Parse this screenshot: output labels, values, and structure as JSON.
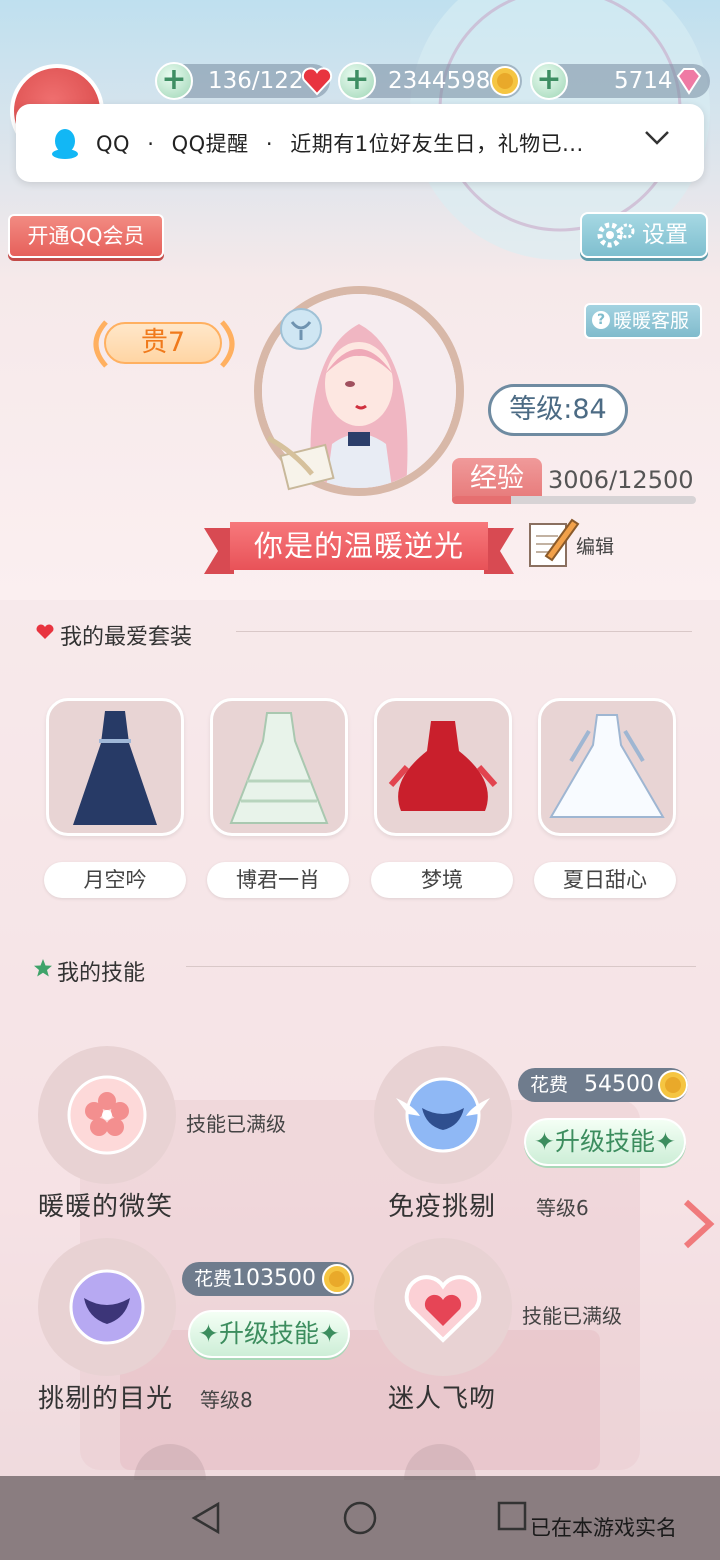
{
  "resources": {
    "stamina": "136/122",
    "gold": "2344598",
    "diamonds": "5714"
  },
  "notification": {
    "app": "QQ",
    "separator": "·",
    "channel": "QQ提醒",
    "message": "近期有1位好友生日，礼物已..."
  },
  "header": {
    "vip_label": "开通QQ会员",
    "settings_label": "设置",
    "service_label": "暖暖客服",
    "service_q": "?"
  },
  "profile": {
    "rank": "贵7",
    "level": "等级:84",
    "exp_label": "经验",
    "exp_value": "3006/12500",
    "exp_progress": 0.2405,
    "signature": "你是的温暖逆光",
    "edit_label": "编辑"
  },
  "favorites": {
    "title": "我的最爱套装",
    "items": [
      {
        "name": "月空吟"
      },
      {
        "name": "博君一肖"
      },
      {
        "name": "梦境"
      },
      {
        "name": "夏日甜心"
      }
    ]
  },
  "skills": {
    "title": "我的技能",
    "items": [
      {
        "name": "暖暖的微笑",
        "status": "技能已满级",
        "icon": "sakura-icon"
      },
      {
        "name": "免疫挑剔",
        "cost_label": "花费",
        "cost": "54500",
        "upgrade": "升级技能",
        "level": "等级6",
        "icon": "winged-mask-icon"
      },
      {
        "name": "挑剔的目光",
        "cost_label": "花费",
        "cost": "103500",
        "upgrade": "升级技能",
        "level": "等级8",
        "icon": "mask-icon"
      },
      {
        "name": "迷人飞吻",
        "status": "技能已满级",
        "icon": "heart-icon"
      }
    ]
  },
  "system": {
    "realname": "已在本游戏实名"
  },
  "colors": {
    "accent_red": "#e85258",
    "upgrade_green": "#3c8d5e",
    "level_blue": "#4c6b84"
  }
}
